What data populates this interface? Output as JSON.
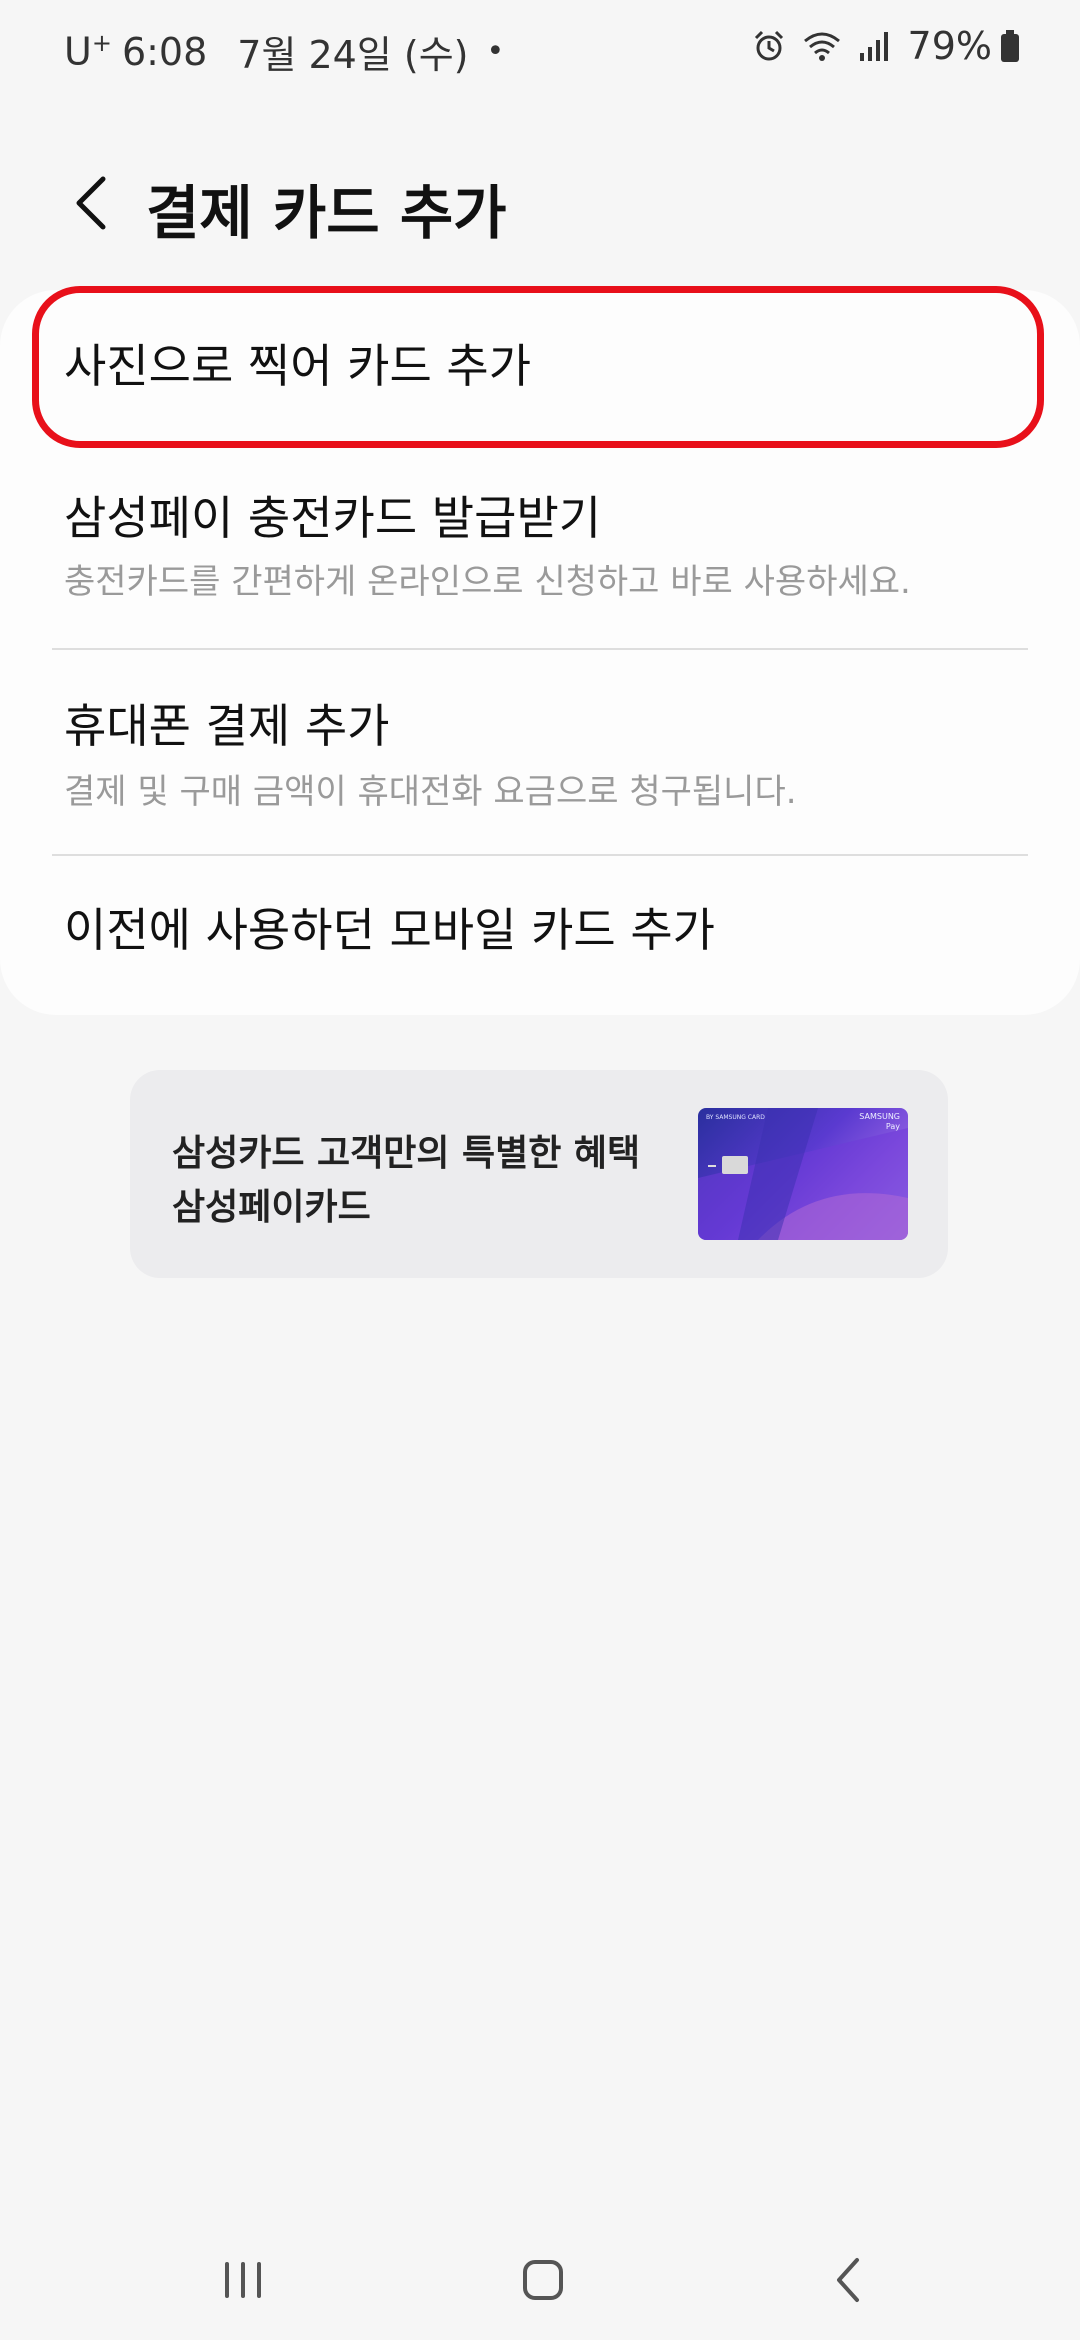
{
  "status_bar": {
    "carrier": "U",
    "carrier_sup": "+",
    "time": "6:08",
    "date": "7월 24일 (수)",
    "dot": "•",
    "battery": "79%",
    "icons": [
      "alarm-icon",
      "wifi-icon",
      "signal-icon",
      "battery-icon"
    ]
  },
  "header": {
    "title": "결제 카드 추가",
    "back_icon": "chevron-left-icon"
  },
  "menu": {
    "items": [
      {
        "title": "사진으로 찍어 카드 추가",
        "subtitle": ""
      },
      {
        "title": "삼성페이 충전카드 발급받기",
        "subtitle": "충전카드를 간편하게 온라인으로 신청하고 바로 사용하세요."
      },
      {
        "title": "휴대폰 결제 추가",
        "subtitle": "결제 및 구매 금액이 휴대전화 요금으로 청구됩니다."
      },
      {
        "title": "이전에 사용하던 모바일 카드 추가",
        "subtitle": ""
      }
    ]
  },
  "promo": {
    "line1": "삼성카드 고객만의 특별한 혜택",
    "line2": "삼성페이카드",
    "card_brand": "SAMSUNG",
    "card_pay": "Pay",
    "card_issuer": "BY SAMSUNG CARD"
  },
  "nav": {
    "recents_icon": "recents-icon",
    "home_icon": "home-icon",
    "back_icon": "back-icon"
  },
  "colors": {
    "highlight": "#e8101a",
    "background": "#f6f6f6",
    "card_surface": "#fdfdfd",
    "subtitle": "#9a9a9a"
  }
}
